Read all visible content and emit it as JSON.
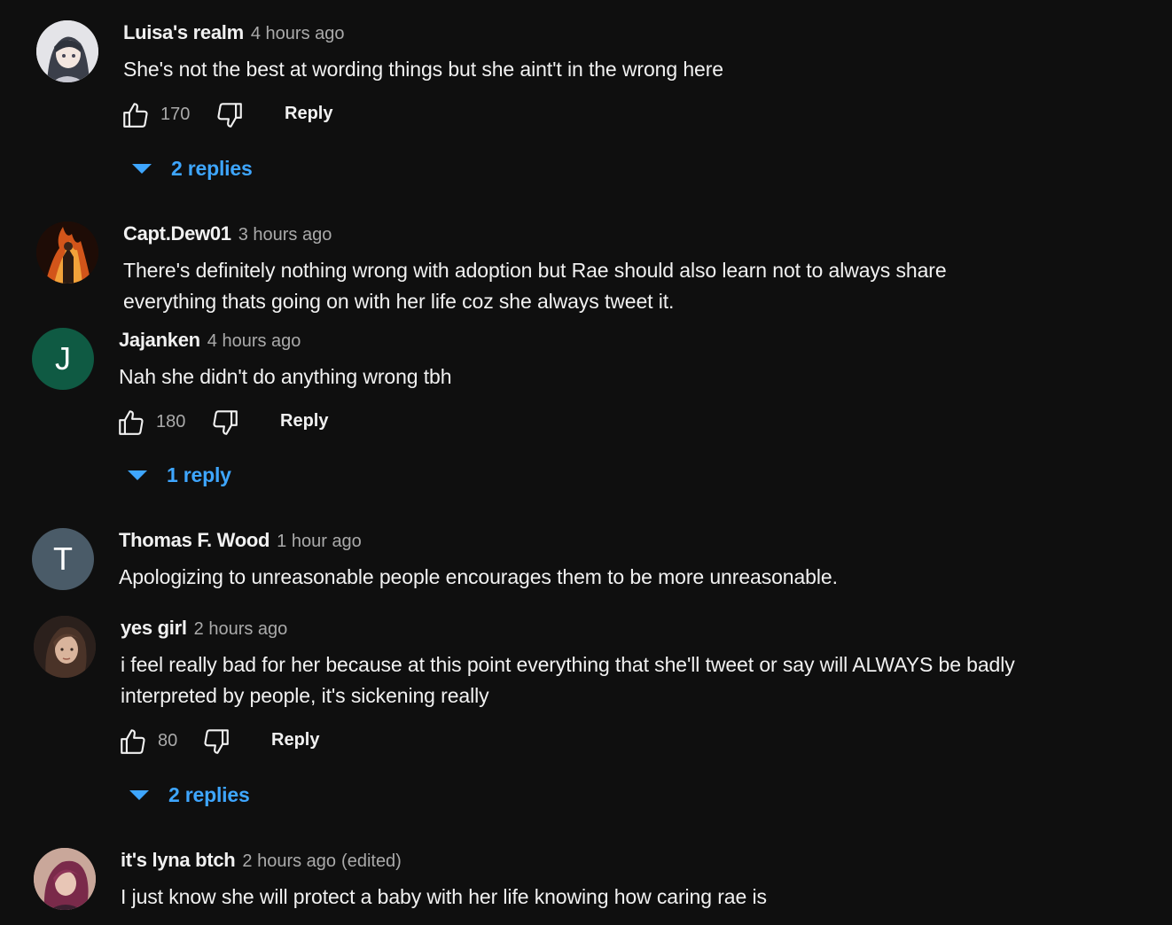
{
  "colors": {
    "background": "#0f0f0f",
    "text_primary": "#f1f1f1",
    "text_secondary": "#aaaaaa",
    "link_blue": "#3ea6ff",
    "avatar_j": "#0f5a43",
    "avatar_t": "#4a5b68"
  },
  "comments": [
    {
      "author": "Luisa's realm",
      "time": "4 hours ago",
      "text": "She's not the best at wording things but she aint't in the wrong here",
      "likes": "170",
      "reply_label": "Reply",
      "replies": "2 replies",
      "avatar": "anime-girl-avatar"
    },
    {
      "author": "Capt.Dew01",
      "time": "3 hours ago",
      "text": "There's definitely nothing wrong with adoption but Rae should also learn not to always share everything thats going on with her life coz she always tweet it.",
      "avatar": "fire-figure-avatar"
    },
    {
      "author": "Jajanken",
      "time": "4 hours ago",
      "text": "Nah she didn't do anything wrong tbh",
      "likes": "180",
      "reply_label": "Reply",
      "replies": "1 reply",
      "avatar_letter": "J"
    },
    {
      "author": "Thomas F. Wood",
      "time": "1 hour ago",
      "text": "Apologizing to unreasonable people encourages them to be more unreasonable.",
      "avatar_letter": "T"
    },
    {
      "author": "yes girl",
      "time": "2 hours ago",
      "text": "i feel really bad for her because at this point everything that she'll tweet or say will ALWAYS be badly interpreted by people, it's sickening really",
      "likes": "80",
      "reply_label": "Reply",
      "replies": "2 replies",
      "avatar": "woman-portrait-avatar"
    },
    {
      "author": "it's lyna btch",
      "time": "2 hours ago",
      "edited": "(edited)",
      "text": "I just know she will protect a baby with her life knowing how caring rae is",
      "avatar": "pink-hair-avatar"
    }
  ]
}
